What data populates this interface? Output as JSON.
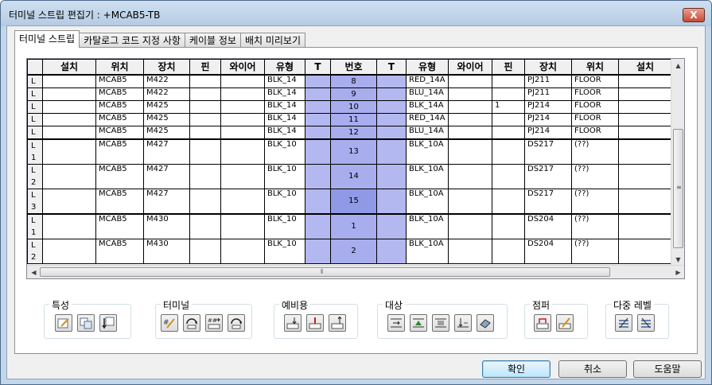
{
  "window": {
    "title": "터미널 스트립 편집기 : +MCAB5-TB",
    "close_label": "X"
  },
  "tabs": [
    {
      "label": "터미널 스트립",
      "active": true
    },
    {
      "label": "카탈로그 코드 지정 사항",
      "active": false
    },
    {
      "label": "케이블 정보",
      "active": false
    },
    {
      "label": "배치 미리보기",
      "active": false
    }
  ],
  "grid": {
    "columns": [
      "",
      "설치",
      "위치",
      "장치",
      "핀",
      "와이어",
      "유형",
      "T",
      "번호",
      "T",
      "유형",
      "와이어",
      "핀",
      "장치",
      "위치",
      "설치"
    ],
    "rows": [
      {
        "id": "r8",
        "group": "L",
        "l_inst": "",
        "l_loc": "MCAB5",
        "l_dev": "M422",
        "l_pin": "",
        "l_wire": "",
        "l_type": "BLK_14",
        "num": "8",
        "r_type": "RED_14A",
        "r_wire": "",
        "r_pin": "",
        "r_dev": "PJ211",
        "r_loc": "FLOOR",
        "r_inst": ""
      },
      {
        "id": "r9",
        "group": "L",
        "l_inst": "",
        "l_loc": "MCAB5",
        "l_dev": "M422",
        "l_pin": "",
        "l_wire": "",
        "l_type": "BLK_14",
        "num": "9",
        "r_type": "BLU_14A",
        "r_wire": "",
        "r_pin": "",
        "r_dev": "PJ211",
        "r_loc": "FLOOR",
        "r_inst": ""
      },
      {
        "id": "r10",
        "group": "L",
        "l_inst": "",
        "l_loc": "MCAB5",
        "l_dev": "M425",
        "l_pin": "",
        "l_wire": "",
        "l_type": "BLK_14",
        "num": "10",
        "r_type": "BLK_14A",
        "r_wire": "",
        "r_pin": "1",
        "r_dev": "PJ214",
        "r_loc": "FLOOR",
        "r_inst": ""
      },
      {
        "id": "r11",
        "group": "L",
        "l_inst": "",
        "l_loc": "MCAB5",
        "l_dev": "M425",
        "l_pin": "",
        "l_wire": "",
        "l_type": "BLK_14",
        "num": "11",
        "r_type": "RED_14A",
        "r_wire": "",
        "r_pin": "",
        "r_dev": "PJ214",
        "r_loc": "FLOOR",
        "r_inst": ""
      },
      {
        "id": "r12",
        "group": "L",
        "l_inst": "",
        "l_loc": "MCAB5",
        "l_dev": "M425",
        "l_pin": "",
        "l_wire": "",
        "l_type": "BLK_14",
        "num": "12",
        "r_type": "BLU_14A",
        "r_wire": "",
        "r_pin": "",
        "r_dev": "PJ214",
        "r_loc": "FLOOR",
        "r_inst": ""
      },
      {
        "id": "r13",
        "group": "L 1",
        "l_inst": "",
        "l_loc": "MCAB5",
        "l_dev": "M427",
        "l_pin": "",
        "l_wire": "",
        "l_type": "BLK_10",
        "num": "13",
        "r_type": "BLK_10A",
        "r_wire": "",
        "r_pin": "",
        "r_dev": "DS217",
        "r_loc": "(??)",
        "r_inst": ""
      },
      {
        "id": "r14",
        "group": "L 2",
        "l_inst": "",
        "l_loc": "MCAB5",
        "l_dev": "M427",
        "l_pin": "",
        "l_wire": "",
        "l_type": "BLK_10",
        "num": "14",
        "r_type": "BLK_10A",
        "r_wire": "",
        "r_pin": "",
        "r_dev": "DS217",
        "r_loc": "(??)",
        "r_inst": ""
      },
      {
        "id": "r15",
        "group": "L 3",
        "l_inst": "",
        "l_loc": "MCAB5",
        "l_dev": "M427",
        "l_pin": "",
        "l_wire": "",
        "l_type": "BLK_10",
        "num": "15",
        "r_type": "BLK_10A",
        "r_wire": "",
        "r_pin": "",
        "r_dev": "DS217",
        "r_loc": "(??)",
        "r_inst": ""
      },
      {
        "id": "r1",
        "group": "L 1",
        "l_inst": "",
        "l_loc": "MCAB5",
        "l_dev": "M430",
        "l_pin": "",
        "l_wire": "",
        "l_type": "BLK_10",
        "num": "1",
        "r_type": "BLK_10A",
        "r_wire": "",
        "r_pin": "",
        "r_dev": "DS204",
        "r_loc": "(??)",
        "r_inst": ""
      },
      {
        "id": "r2",
        "group": "L 2",
        "l_inst": "",
        "l_loc": "MCAB5",
        "l_dev": "M430",
        "l_pin": "",
        "l_wire": "",
        "l_type": "BLK_10",
        "num": "2",
        "r_type": "BLK_10A",
        "r_wire": "",
        "r_pin": "",
        "r_dev": "DS204",
        "r_loc": "(??)",
        "r_inst": ""
      }
    ]
  },
  "toolgroups": {
    "properties": {
      "label": "특성",
      "icons": [
        "edit-properties-icon",
        "copy-properties-icon",
        "swap-properties-icon"
      ]
    },
    "terminal": {
      "label": "터미널",
      "icons": [
        "edit-terminal-icon",
        "rotate-terminal-icon",
        "renumber-terminal-icon",
        "refresh-terminal-icon"
      ]
    },
    "spare": {
      "label": "예비용",
      "icons": [
        "add-spare-icon",
        "insert-spare-icon",
        "remove-spare-icon"
      ]
    },
    "target": {
      "label": "대상",
      "icons": [
        "move-up-icon",
        "move-top-icon",
        "move-down-icon",
        "move-bottom-icon",
        "reverse-icon"
      ]
    },
    "jumper": {
      "label": "점퍼",
      "icons": [
        "add-jumper-icon",
        "edit-jumper-icon"
      ]
    },
    "multilevel": {
      "label": "다중 레벨",
      "icons": [
        "levels-icon",
        "levels-edit-icon"
      ]
    }
  },
  "footer": {
    "ok_label": "확인",
    "cancel_label": "취소",
    "help_label": "도움말"
  },
  "colors": {
    "accent_blue": "#a8adee",
    "title_bar": "#c3d6ea",
    "close_red": "#c74b35"
  }
}
